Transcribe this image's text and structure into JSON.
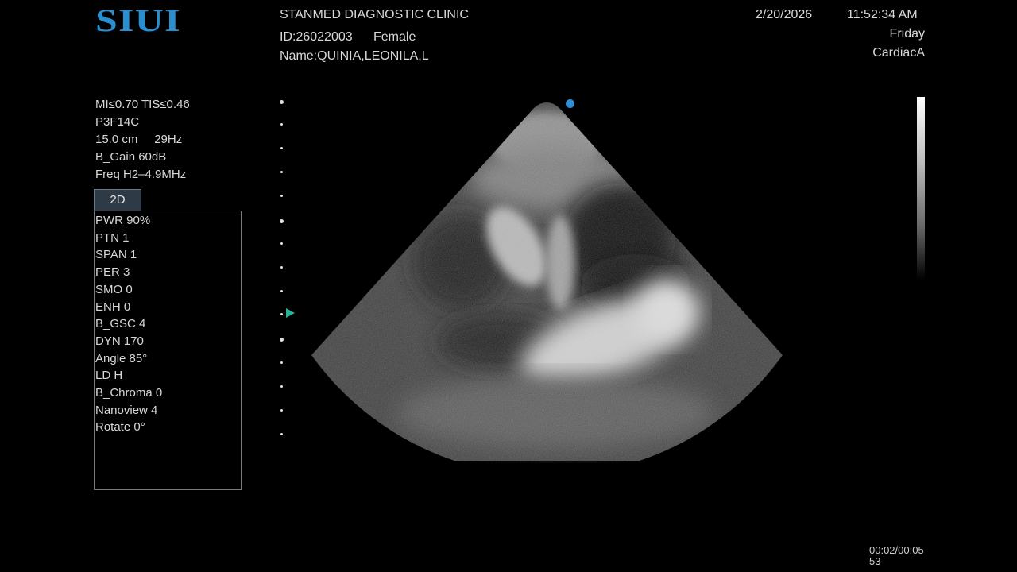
{
  "header": {
    "logo": "SIUI",
    "clinic": "STANMED DIAGNOSTIC CLINIC",
    "patient_id": "ID:26022003",
    "patient_sex": "Female",
    "patient_name": "Name:QUINIA,LEONILA,L",
    "date": "2/20/2026",
    "time": "11:52:34 AM",
    "weekday": "Friday",
    "preset": "CardiacA"
  },
  "params": {
    "mi_tis": "MI≤0.70 TIS≤0.46",
    "probe": "P3F14C",
    "depth_fps": "15.0 cm     29Hz",
    "gain": "B_Gain 60dB",
    "freq": "Freq H2–4.9MHz"
  },
  "mode_tab": "2D",
  "settings": [
    "PWR 90%",
    "PTN 1",
    "SPAN 1",
    "PER 3",
    "SMO 0",
    "ENH 0",
    "B_GSC 4",
    "DYN 170",
    "Angle 85°",
    "LD H",
    "B_Chroma 0",
    "Nanoview 4",
    "Rotate 0°"
  ],
  "cine": {
    "line1": "00:02/00:05",
    "line2": "53"
  },
  "colors": {
    "logo": "#2a8fd0",
    "orientation_marker": "#2e8fd8",
    "focus_marker": "#2bb39a",
    "text": "#d8d8d8",
    "background": "#000000"
  },
  "icons": {
    "focus_marker": "triangle-right",
    "orientation_marker": "dot"
  }
}
